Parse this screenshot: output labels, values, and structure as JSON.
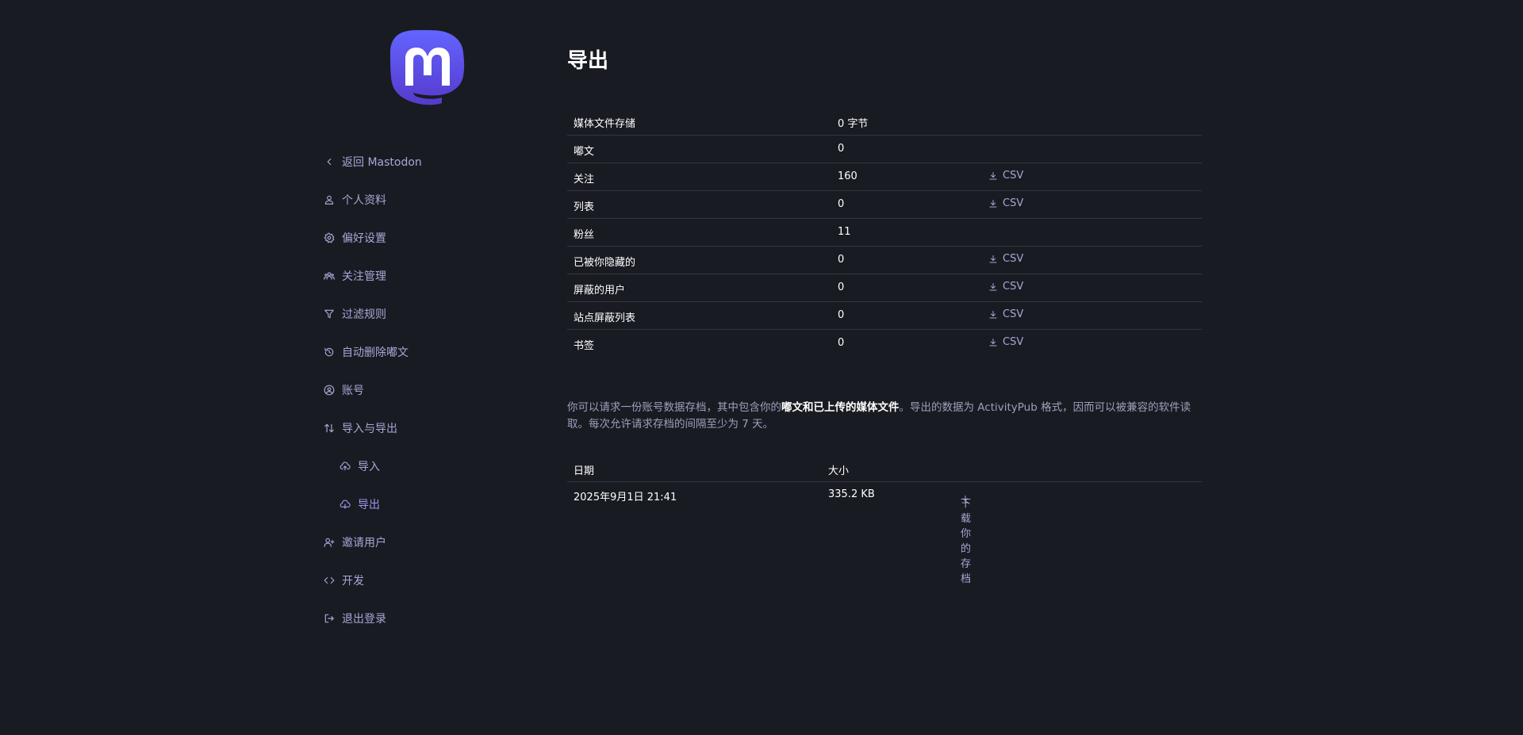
{
  "colors": {
    "background": "#191b22",
    "accent": "#9a97ee",
    "link": "#a9a6d6",
    "brand_gradient_top": "#6364ff",
    "brand_gradient_bottom": "#563acc"
  },
  "sidebar": {
    "logo_icon": "mastodon-logo",
    "items": [
      {
        "label": "返回 Mastodon",
        "icon": "chevron-left-icon"
      },
      {
        "label": "个人资料",
        "icon": "person-icon"
      },
      {
        "label": "偏好设置",
        "icon": "gear-icon"
      },
      {
        "label": "关注管理",
        "icon": "people-icon"
      },
      {
        "label": "过滤规则",
        "icon": "filter-icon"
      },
      {
        "label": "自动删除嘟文",
        "icon": "history-icon"
      },
      {
        "label": "账号",
        "icon": "account-circle-icon"
      },
      {
        "label": "导入与导出",
        "icon": "import-export-icon"
      },
      {
        "label": "导入",
        "icon": "cloud-upload-icon",
        "sub": true
      },
      {
        "label": "导出",
        "icon": "cloud-download-icon",
        "sub": true,
        "active": true
      },
      {
        "label": "邀请用户",
        "icon": "person-add-icon"
      },
      {
        "label": "开发",
        "icon": "code-icon"
      },
      {
        "label": "退出登录",
        "icon": "logout-icon"
      }
    ]
  },
  "main": {
    "title": "导出",
    "stats": [
      {
        "label": "媒体文件存储",
        "value": "0 字节",
        "csv": ""
      },
      {
        "label": "嘟文",
        "value": "0",
        "csv": ""
      },
      {
        "label": "关注",
        "value": "160",
        "csv": "CSV"
      },
      {
        "label": "列表",
        "value": "0",
        "csv": "CSV"
      },
      {
        "label": "粉丝",
        "value": "11",
        "csv": ""
      },
      {
        "label": "已被你隐藏的",
        "value": "0",
        "csv": "CSV"
      },
      {
        "label": "屏蔽的用户",
        "value": "0",
        "csv": "CSV"
      },
      {
        "label": "站点屏蔽列表",
        "value": "0",
        "csv": "CSV"
      },
      {
        "label": "书签",
        "value": "0",
        "csv": "CSV"
      }
    ],
    "hint": {
      "before": "你可以请求一份账号数据存档，其中包含你的",
      "strong": "嘟文和已上传的媒体文件",
      "after": "。导出的数据为 ActivityPub 格式，因而可以被兼容的软件读取。每次允许请求存档的间隔至少为 7 天。"
    },
    "archives": {
      "headers": {
        "date": "日期",
        "size": "大小"
      },
      "rows": [
        {
          "date": "2025年9月1日 21:41",
          "size": "335.2 KB",
          "action": "下载你的存档"
        }
      ]
    }
  }
}
